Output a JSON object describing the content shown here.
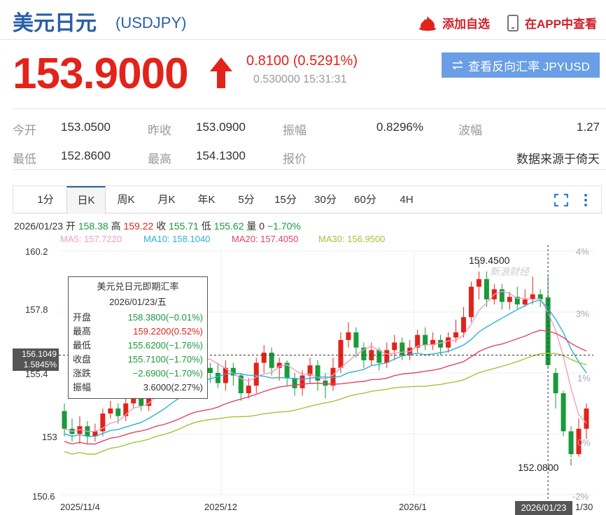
{
  "header": {
    "title": "美元日元",
    "symbol": "(USDJPY)",
    "add_watch": "添加自选",
    "open_app": "在APP中查看"
  },
  "quote": {
    "price": "153.9000",
    "change": "0.8100 (0.5291%)",
    "spread_time": "0.530000 15:31:31",
    "swap_button": "查看反向汇率 JPYUSD",
    "colors": {
      "up": "#e2231a",
      "down": "#1a9a3a",
      "accent": "#2a5fa8"
    }
  },
  "stats": [
    {
      "label": "今开",
      "value": "153.0500"
    },
    {
      "label": "昨收",
      "value": "153.0900"
    },
    {
      "label": "振幅",
      "value": "0.8296%"
    },
    {
      "label": "波幅",
      "value": "1.27"
    },
    {
      "label": "最低",
      "value": "152.8600"
    },
    {
      "label": "最高",
      "value": "154.1300"
    },
    {
      "label": "报价",
      "value": ""
    },
    {
      "label": "",
      "value": "数据来源于倚天"
    }
  ],
  "tabs": [
    "1分",
    "日K",
    "周K",
    "月K",
    "年K",
    "5分",
    "15分",
    "30分",
    "60分",
    "4H"
  ],
  "active_tab": "日K",
  "info_line": {
    "date": "2026/01/23",
    "open_l": "开",
    "open": "158.38",
    "high_l": "高",
    "high": "159.22",
    "close_l": "收",
    "close": "155.71",
    "low_l": "低",
    "low": "155.62",
    "vol_l": "量",
    "vol": "0",
    "pct": "−1.70%"
  },
  "ma": [
    {
      "label": "MA5: 157.7220",
      "color": "#f19ec2"
    },
    {
      "label": "MA10: 158.1040",
      "color": "#2bb3d6"
    },
    {
      "label": "MA20: 157.4050",
      "color": "#e0456a"
    },
    {
      "label": "MA30: 156.9500",
      "color": "#a6c33a"
    }
  ],
  "tooltip": {
    "title": "美元兑日元即期汇率",
    "date": "2026/01/23/五",
    "rows": [
      {
        "k": "开盘",
        "v": "158.3800(−0.01%)"
      },
      {
        "k": "最高",
        "v": "159.2200(0.52%)"
      },
      {
        "k": "最低",
        "v": "155.6200(−1.76%)"
      },
      {
        "k": "收盘",
        "v": "155.7100(−1.70%)"
      },
      {
        "k": "涨跌",
        "v": "−2.6900(−1.70%)"
      },
      {
        "k": "振幅",
        "v": "3.6000(2.27%)"
      }
    ]
  },
  "crosshair": {
    "price": "156.1049",
    "pct": "1.5845%",
    "date": "2026/01/23"
  },
  "watermark": "新浪财经",
  "chart_data": {
    "type": "candlestick",
    "y_ticks": [
      "160.2",
      "157.8",
      "155.4",
      "153",
      "150.6"
    ],
    "right_ticks": [
      "4%",
      "3%",
      "1%",
      "0%",
      "-2%"
    ],
    "x_ticks": [
      "2025/11/4",
      "2025/12",
      "2026/1",
      "1/30"
    ],
    "ylim": [
      150.6,
      160.2
    ],
    "max_label": "159.4500",
    "min_label": "152.0800",
    "candles": [
      [
        153.9,
        153.2,
        154.2,
        152.9
      ],
      [
        153.2,
        153.0,
        153.6,
        152.7
      ],
      [
        153.0,
        153.3,
        153.7,
        152.6
      ],
      [
        153.3,
        152.9,
        153.5,
        152.6
      ],
      [
        152.9,
        153.1,
        153.4,
        152.7
      ],
      [
        153.1,
        153.8,
        154.0,
        152.9
      ],
      [
        153.8,
        154.0,
        154.3,
        153.6
      ],
      [
        154.0,
        153.7,
        154.2,
        153.4
      ],
      [
        153.7,
        154.2,
        154.4,
        153.5
      ],
      [
        154.2,
        154.4,
        154.7,
        154.0
      ],
      [
        154.4,
        154.1,
        154.6,
        153.9
      ],
      [
        154.1,
        154.6,
        154.9,
        153.9
      ],
      [
        154.6,
        155.1,
        155.4,
        154.4
      ],
      [
        155.1,
        154.8,
        155.3,
        154.5
      ],
      [
        154.8,
        155.4,
        155.6,
        154.6
      ],
      [
        155.4,
        155.9,
        156.3,
        155.2
      ],
      [
        155.9,
        156.5,
        156.8,
        155.7
      ],
      [
        156.5,
        156.3,
        156.7,
        155.9
      ],
      [
        156.3,
        155.6,
        156.4,
        155.2
      ],
      [
        155.6,
        155.4,
        155.8,
        155.0
      ],
      [
        155.4,
        155.0,
        155.8,
        154.8
      ],
      [
        155.0,
        155.6,
        155.9,
        154.7
      ],
      [
        155.6,
        155.3,
        155.8,
        154.9
      ],
      [
        155.3,
        154.6,
        155.4,
        154.3
      ],
      [
        154.6,
        154.9,
        155.2,
        154.4
      ],
      [
        154.9,
        155.8,
        156.0,
        154.6
      ],
      [
        155.8,
        156.2,
        156.5,
        155.4
      ],
      [
        156.2,
        155.6,
        156.4,
        155.3
      ],
      [
        155.6,
        155.8,
        156.0,
        155.1
      ],
      [
        155.8,
        155.2,
        155.9,
        154.9
      ],
      [
        155.2,
        154.8,
        155.4,
        154.5
      ],
      [
        154.8,
        155.3,
        155.5,
        154.5
      ],
      [
        155.3,
        155.7,
        156.0,
        155.0
      ],
      [
        155.7,
        155.1,
        155.9,
        154.7
      ],
      [
        155.1,
        154.9,
        155.4,
        154.4
      ],
      [
        154.9,
        155.6,
        156.0,
        154.7
      ],
      [
        155.6,
        156.7,
        157.0,
        155.4
      ],
      [
        156.7,
        157.0,
        157.4,
        156.4
      ],
      [
        157.0,
        156.4,
        157.2,
        156.0
      ],
      [
        156.4,
        155.9,
        156.6,
        155.6
      ],
      [
        155.9,
        156.3,
        156.6,
        155.7
      ],
      [
        156.3,
        155.8,
        156.4,
        155.5
      ],
      [
        155.8,
        156.3,
        156.6,
        155.6
      ],
      [
        156.3,
        156.6,
        156.9,
        155.9
      ],
      [
        156.6,
        156.1,
        156.8,
        155.9
      ],
      [
        156.1,
        156.4,
        156.7,
        155.9
      ],
      [
        156.4,
        156.9,
        157.1,
        156.2
      ],
      [
        156.9,
        156.5,
        157.2,
        156.3
      ],
      [
        156.5,
        156.7,
        157.0,
        156.3
      ],
      [
        156.7,
        156.4,
        156.9,
        156.1
      ],
      [
        156.4,
        156.8,
        157.0,
        156.2
      ],
      [
        156.8,
        157.0,
        157.5,
        156.6
      ],
      [
        157.0,
        157.6,
        158.0,
        156.8
      ],
      [
        157.6,
        158.8,
        159.0,
        157.4
      ],
      [
        158.8,
        159.1,
        159.4,
        158.3
      ],
      [
        159.1,
        158.3,
        159.4,
        158.0
      ],
      [
        158.3,
        158.7,
        158.9,
        158.1
      ],
      [
        158.7,
        158.2,
        158.9,
        157.9
      ],
      [
        158.2,
        158.4,
        158.6,
        157.9
      ],
      [
        158.4,
        158.1,
        158.8,
        157.9
      ],
      [
        158.1,
        158.3,
        158.7,
        158.0
      ],
      [
        158.3,
        158.5,
        159.2,
        158.1
      ],
      [
        158.5,
        158.3,
        158.7,
        158.0
      ],
      [
        158.38,
        155.71,
        159.22,
        155.62
      ],
      [
        155.4,
        154.6,
        155.6,
        154.0
      ],
      [
        154.6,
        153.1,
        154.7,
        152.9
      ],
      [
        153.1,
        152.2,
        153.3,
        152.08
      ],
      [
        152.2,
        153.2,
        153.6,
        152.1
      ],
      [
        153.2,
        154.0,
        154.2,
        152.8
      ]
    ]
  }
}
